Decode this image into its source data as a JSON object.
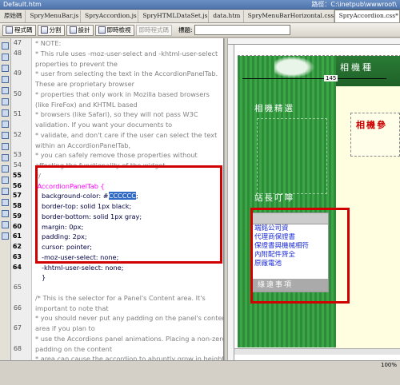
{
  "title": "Default.htm",
  "path": "路徑：C:\\inetpub\\wwwroot\\",
  "file_tabs": [
    "原始碼",
    "SpryMenuBar.js",
    "SpryAccordion.js",
    "SpryHTMLDataSet.js",
    "data.htm",
    "SpryMenuBarHorizontal.css",
    "SpryAccordion.css*"
  ],
  "toolbar": {
    "code": "程式碼",
    "split": "分割",
    "design": "設計",
    "live": "即時檢視",
    "live_code": "即時程式碼",
    "title_label": "標題:"
  },
  "line_numbers": [
    "47",
    "48",
    "",
    "49",
    "",
    "50",
    "",
    "51",
    "",
    "52",
    "",
    "53",
    "54",
    "55",
    "56",
    "57",
    "58",
    "59",
    "60",
    "61",
    "62",
    "63",
    "64",
    "",
    "65",
    "",
    "66",
    "",
    "67",
    "",
    "68",
    ""
  ],
  "code_lines": [
    "* NOTE:",
    "* This rule uses -moz-user-select and -khtml-user-select",
    "properties to prevent the",
    "* user from selecting the text in the AccordionPanelTab.",
    "These are proprietary browser",
    "* properties that only work in Mozilla based browsers",
    "(like FireFox) and KHTML based",
    "* browsers (like Safari), so they will not pass W3C",
    "validation. If you want your documents to",
    "* validate, and don't care if the user can select the text",
    "within an AccordionPanelTab,",
    "* you can safely remove those properties without",
    "affecting the functionality of the widget.",
    "*/",
    ".AccordionPanelTab {",
    "background-color: #",
    "border-top: solid 1px black;",
    "border-bottom: solid 1px gray;",
    "margin: 0px;",
    "padding: 2px;",
    "cursor: pointer;",
    "-moz-user-select: none;",
    "-khtml-user-select: none;",
    "}",
    "",
    "/* This is the selector for a Panel's Content area. It's",
    "important to note that",
    "* you should never put any padding on the panel's content",
    "area if you plan to",
    "* use the Accordions panel animations. Placing a non-zero",
    "padding on the content",
    "* area can cause the accordion to abruptly grow in height",
    "while the panels animate.",
    "*/"
  ],
  "selected_value": "CCCCCC",
  "design": {
    "width_label": "145",
    "header_title": "相機種",
    "info_title": "相機參",
    "section1": "相機精選",
    "section2": "站長叮嚀",
    "accordion_links": [
      "端銘公司資",
      "代理商保證書",
      "保證書與機械相符",
      "內附配件齊全",
      "原廠電池"
    ],
    "accordion_bottom": "綠遠事項"
  },
  "status": {
    "zoom": "100%"
  }
}
